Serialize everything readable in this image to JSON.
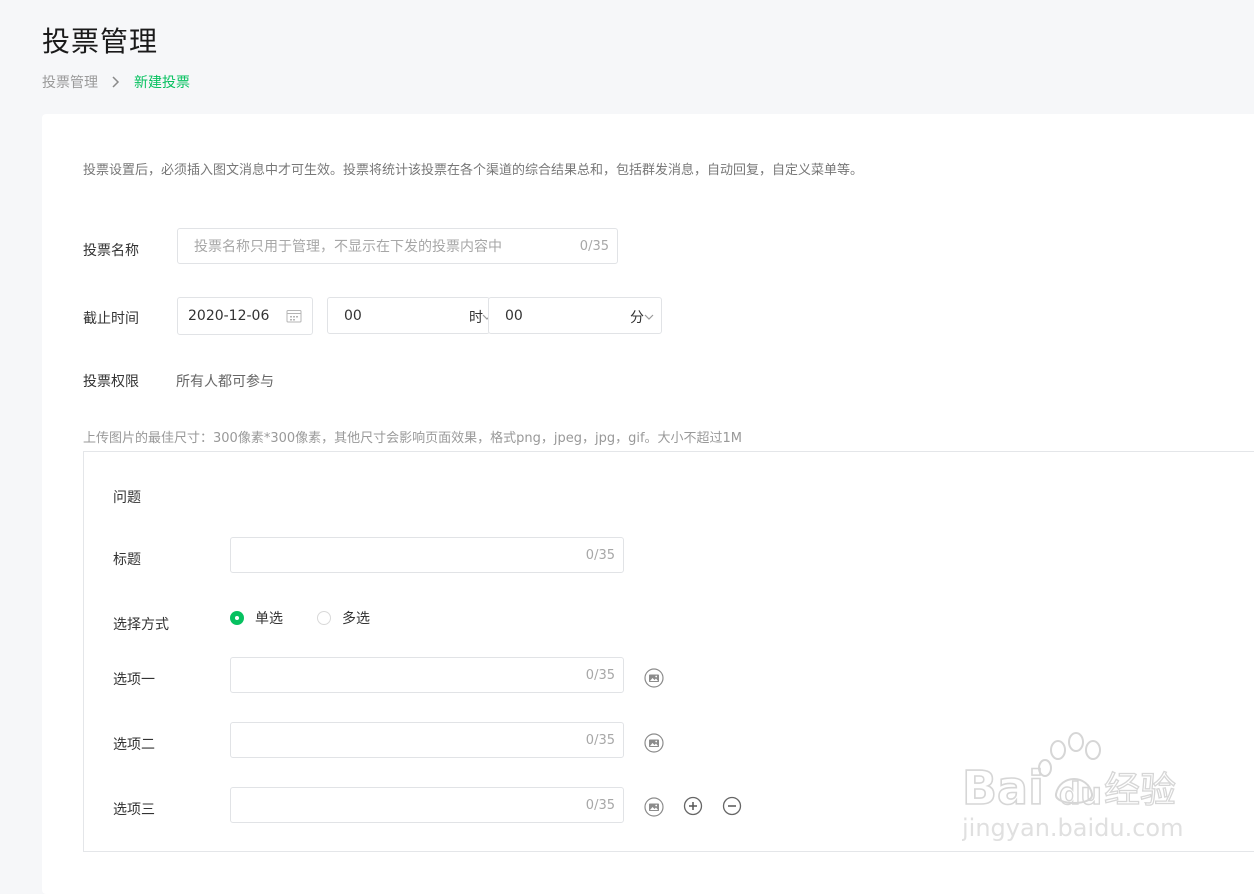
{
  "header": {
    "title": "投票管理",
    "breadcrumb": [
      "投票管理",
      "新建投票"
    ]
  },
  "notice": "投票设置后，必须插入图文消息中才可生效。投票将统计该投票在各个渠道的综合结果总和，包括群发消息，自动回复，自定义菜单等。",
  "form": {
    "name_label": "投票名称",
    "name_placeholder": "投票名称只用于管理，不显示在下发的投票内容中",
    "name_counter": "0/35",
    "deadline_label": "截止时间",
    "date_value": "2020-12-06",
    "hour_value": "00",
    "hour_unit": "时",
    "minute_value": "00",
    "minute_unit": "分",
    "permission_label": "投票权限",
    "permission_value": "所有人都可参与",
    "upload_tip": "上传图片的最佳尺寸：300像素*300像素，其他尺寸会影响页面效果，格式png，jpeg，jpg，gif。大小不超过1M"
  },
  "question": {
    "heading": "问题",
    "title_label": "标题",
    "title_counter": "0/35",
    "mode_label": "选择方式",
    "mode_options": [
      {
        "label": "单选",
        "selected": true
      },
      {
        "label": "多选",
        "selected": false
      }
    ],
    "options": [
      {
        "label": "选项一",
        "counter": "0/35"
      },
      {
        "label": "选项二",
        "counter": "0/35"
      },
      {
        "label": "选项三",
        "counter": "0/35"
      }
    ]
  },
  "icons": {
    "image": "image-upload-icon",
    "add": "plus-circle-icon",
    "remove": "minus-circle-icon",
    "calendar": "calendar-icon"
  },
  "colors": {
    "accent": "#07c160",
    "background": "#f6f7f9"
  },
  "watermark": {
    "brand": "Bai du 经验",
    "url": "jingyan.baidu.com"
  }
}
